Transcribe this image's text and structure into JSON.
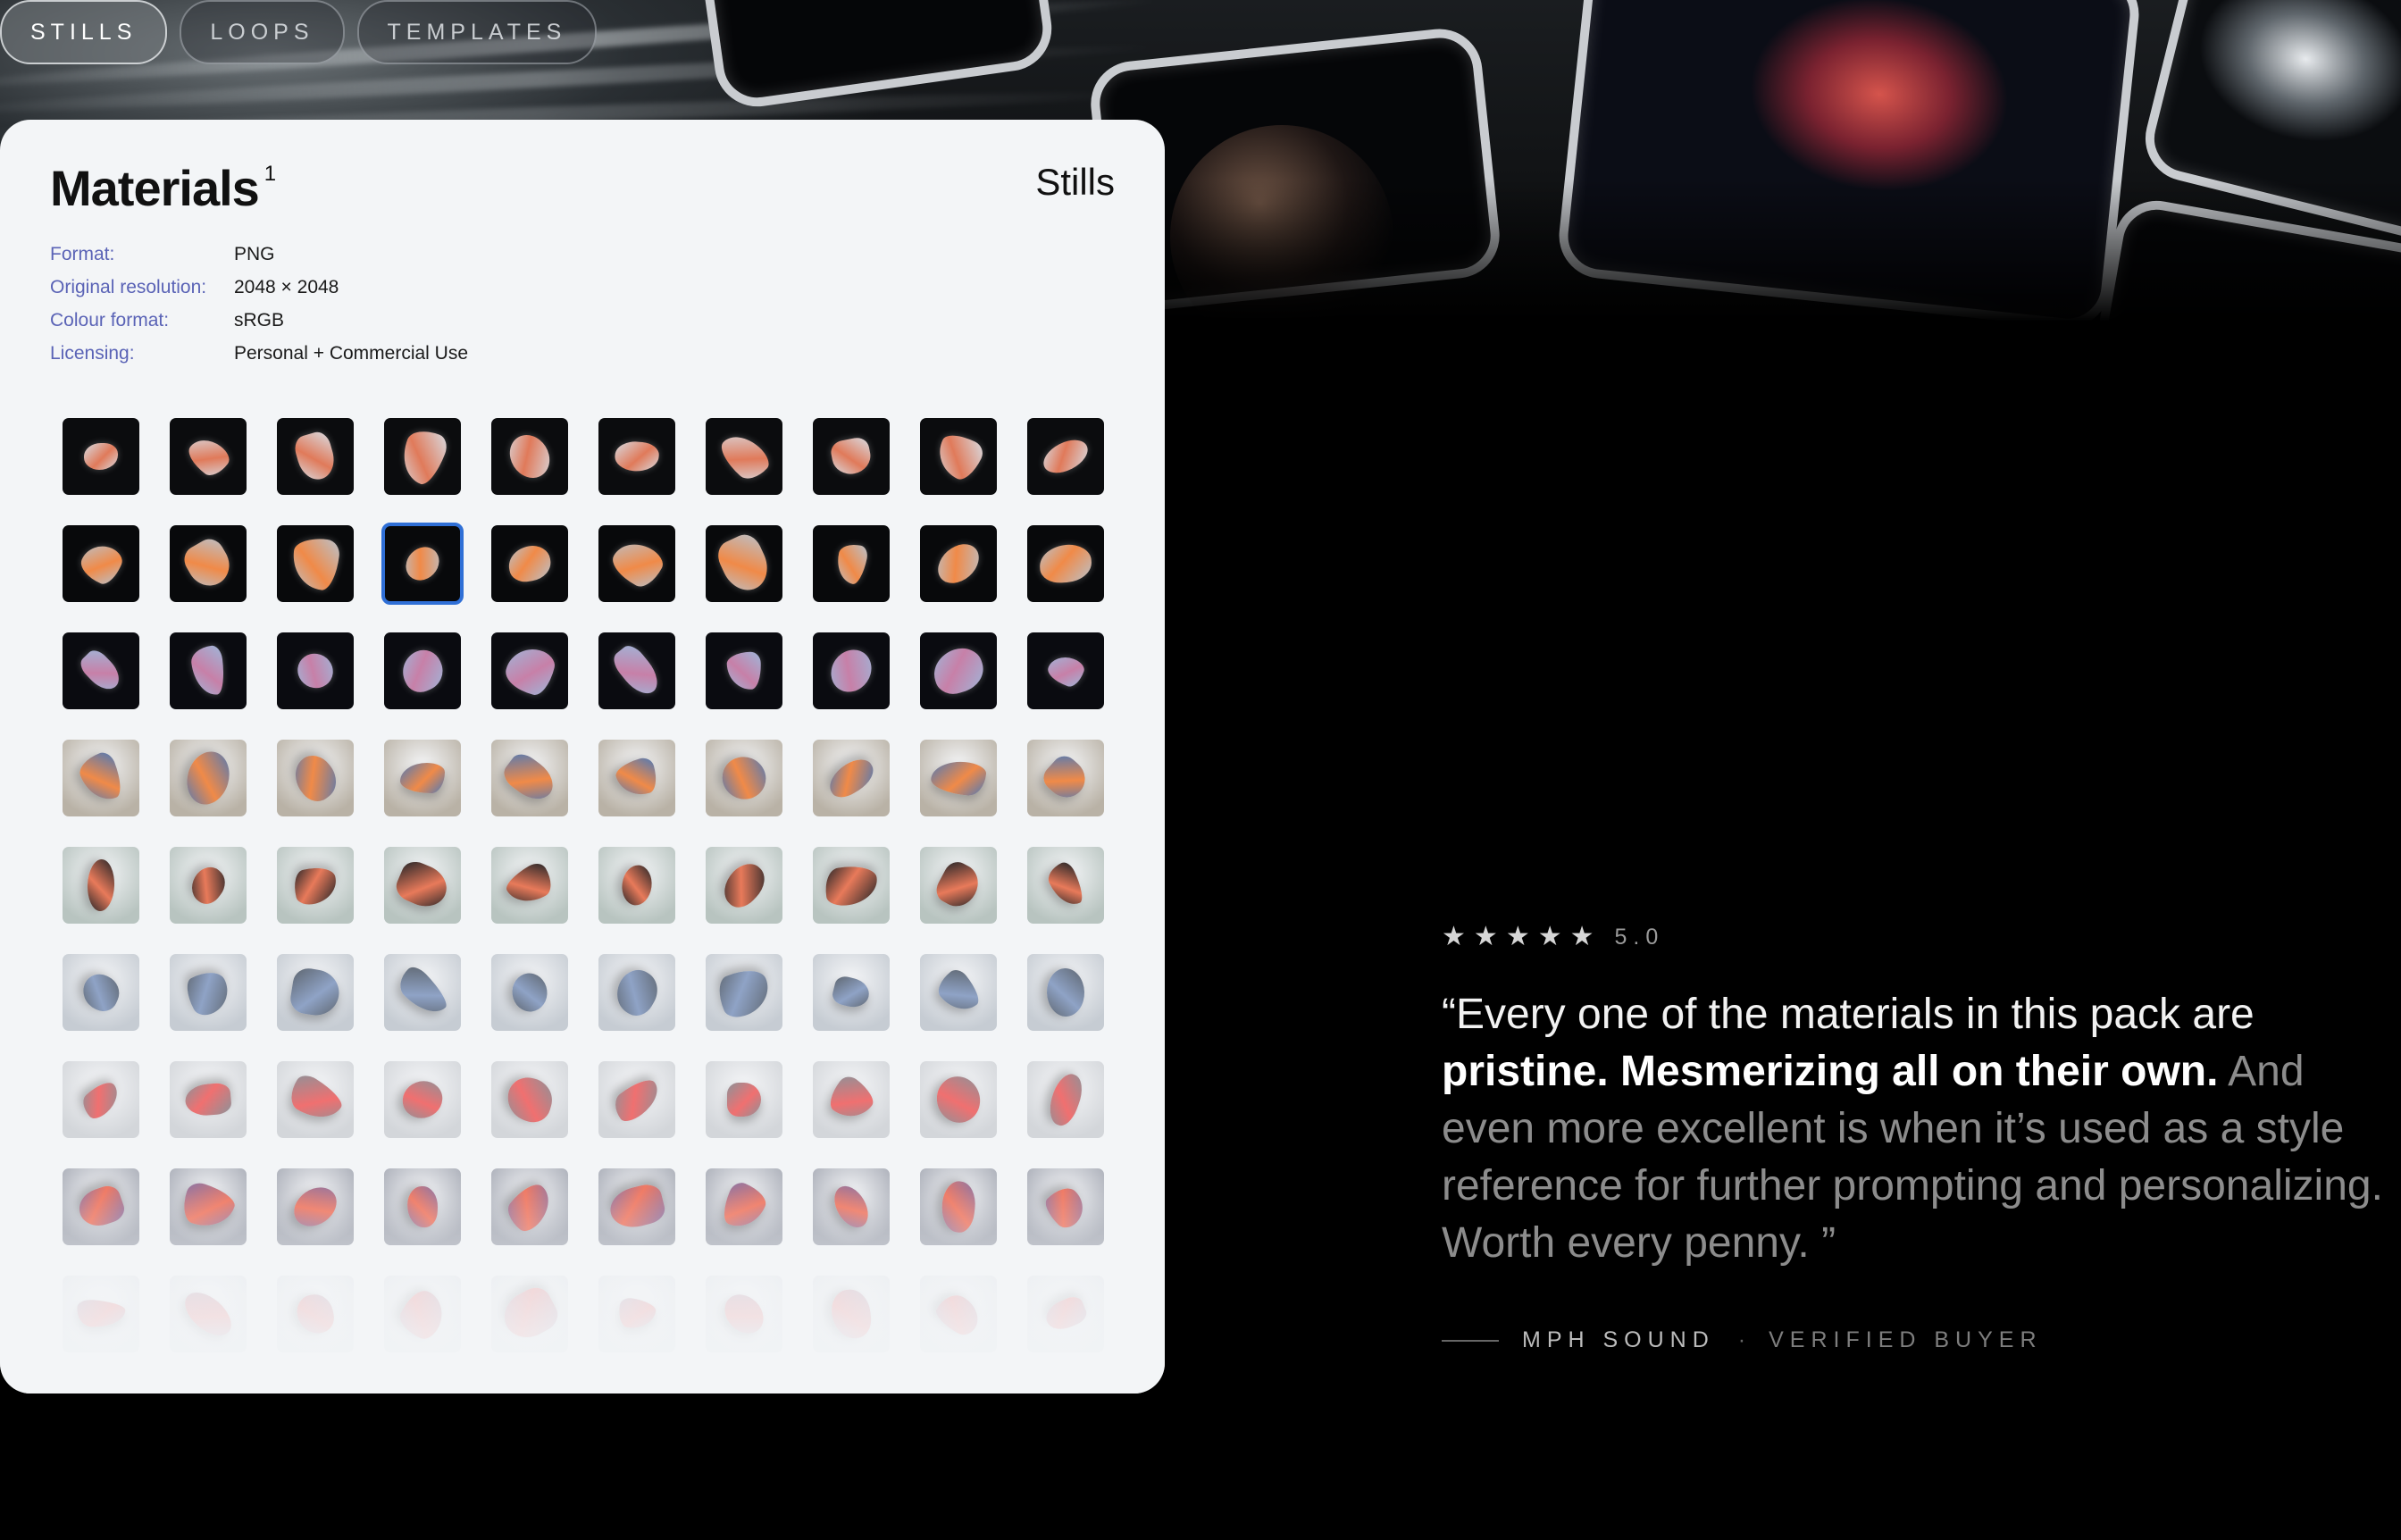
{
  "tabs": [
    {
      "label": "STILLS",
      "active": true
    },
    {
      "label": "LOOPS",
      "active": false
    },
    {
      "label": "TEMPLATES",
      "active": false
    }
  ],
  "card": {
    "title": "Materials",
    "title_sup": "1",
    "kind": "Stills",
    "specs": [
      {
        "label": "Format:",
        "value": "PNG"
      },
      {
        "label": "Original resolution:",
        "value": "2048 × 2048"
      },
      {
        "label": "Colour format:",
        "value": "sRGB"
      },
      {
        "label": "Licensing:",
        "value": "Personal + Commercial Use"
      }
    ],
    "selected_thumbnail": 13,
    "thumbnail_rows": [
      {
        "background": "#0b0c0e",
        "accent": "#d8dde4",
        "glow": "#e07a5a"
      },
      {
        "background": "#08090b",
        "accent": "#b9c2cc",
        "glow": "#f08a48"
      },
      {
        "background": "#0a0b10",
        "accent": "#9fb6d9",
        "glow": "#c780a8"
      },
      {
        "background": "#b9b2a6",
        "accent": "#4d79b8",
        "glow": "#f08a48"
      },
      {
        "background": "#b8c4c0",
        "accent": "#1d2226",
        "glow": "#e87a5a"
      },
      {
        "background": "#c6ccd3",
        "accent": "#5e6670",
        "glow": "#8fa3c6"
      },
      {
        "background": "#d3d6da",
        "accent": "#8d9299",
        "glow": "#f07070"
      },
      {
        "background": "#a9adb7",
        "accent": "#8a76a8",
        "glow": "#f07a64"
      },
      {
        "background": "#dfe3e8",
        "accent": "#b7a9bd",
        "glow": "#ee8a8a"
      }
    ]
  },
  "review": {
    "stars": 5,
    "rating": "5.0",
    "quote_part1": "“Every one of the materials in this pack are",
    "quote_part2": "pristine. Mesmerizing all on their own.",
    "quote_part3": "And even more excellent is when it’s used as a style reference for further prompting and personalizing. Worth every penny. ”",
    "author": "MPH SOUND",
    "separator": "·",
    "badge": "VERIFIED BUYER"
  },
  "icons": {
    "star": "star-icon",
    "thumbnail_art": "abstract-material-shape"
  }
}
